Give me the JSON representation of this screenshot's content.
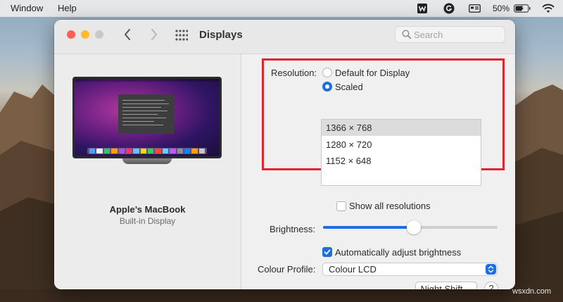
{
  "menubar": {
    "items": [
      "Window",
      "Help"
    ],
    "battery": "50%",
    "icons": [
      "wps-icon",
      "grammarly-icon",
      "keyboard-input-icon",
      "battery-icon",
      "wifi-icon"
    ]
  },
  "window": {
    "title": "Displays",
    "search_placeholder": "Search"
  },
  "display": {
    "name": "Apple’s MacBook",
    "subtitle": "Built-in Display"
  },
  "resolution": {
    "label": "Resolution:",
    "option_default": "Default for Display",
    "option_scaled": "Scaled",
    "selected_option": "Scaled",
    "list": [
      "1366 × 768",
      "1280 × 720",
      "1152 × 648"
    ],
    "selected_resolution": "1366 × 768",
    "show_all_label": "Show all resolutions",
    "show_all_checked": false
  },
  "brightness": {
    "label": "Brightness:",
    "level": 0.52
  },
  "auto_brightness": {
    "label": "Automatically adjust brightness",
    "checked": true
  },
  "colour_profile": {
    "label": "Colour Profile:",
    "value": "Colour LCD"
  },
  "buttons": {
    "night_shift": "Night Shift…",
    "help": "?"
  },
  "watermark": "wsxdn.com",
  "colors": {
    "accent": "#1d6fe0",
    "highlight_box": "#e0252f",
    "close": "#ff5f57",
    "minimize": "#febc2e",
    "zoom_disabled": "#c9c9c9"
  }
}
